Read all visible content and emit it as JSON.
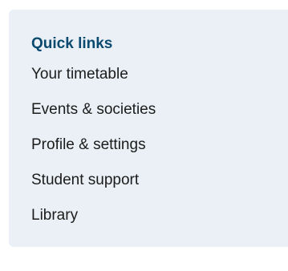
{
  "quick_links": {
    "title": "Quick links",
    "items": [
      {
        "label": "Your timetable"
      },
      {
        "label": "Events & societies"
      },
      {
        "label": "Profile & settings"
      },
      {
        "label": "Student support"
      },
      {
        "label": "Library"
      }
    ]
  },
  "colors": {
    "panel_background": "#eaf0f5",
    "title": "#0b4a6f",
    "link_text": "#1c1c1c"
  }
}
